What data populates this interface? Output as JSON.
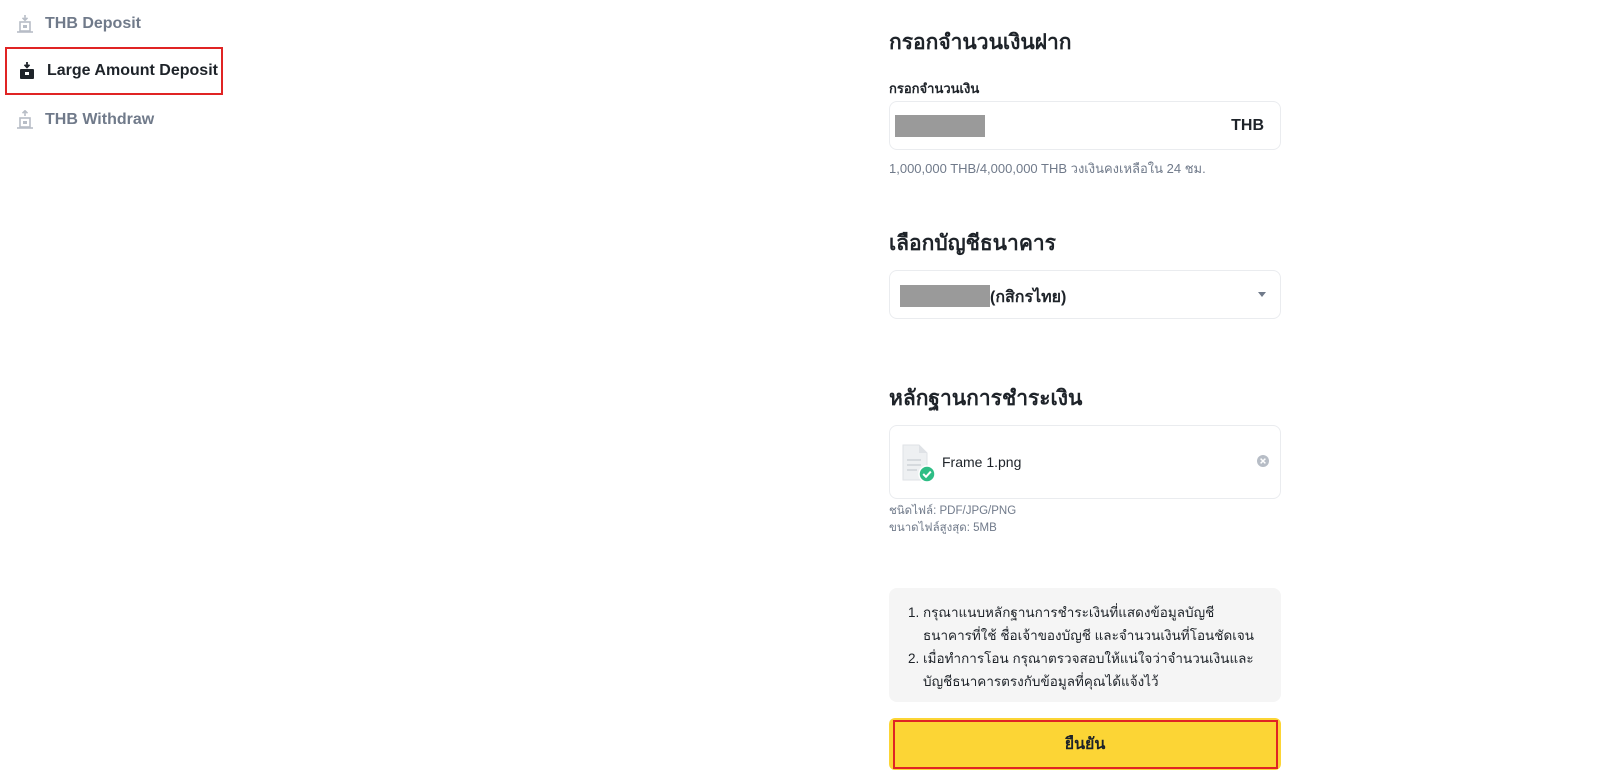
{
  "sidebar": {
    "items": [
      {
        "label": "THB Deposit",
        "icon": "deposit-icon",
        "active": false
      },
      {
        "label": "Large Amount Deposit",
        "icon": "large-deposit-icon",
        "active": true
      },
      {
        "label": "THB Withdraw",
        "icon": "withdraw-icon",
        "active": false
      }
    ]
  },
  "form": {
    "amount_section_title": "กรอกจำนวนเงินฝาก",
    "amount_label": "กรอกจำนวนเงิน",
    "amount_currency": "THB",
    "amount_limit_hint": "1,000,000 THB/4,000,000 THB วงเงินคงเหลือใน 24 ชม.",
    "bank_section_title": "เลือกบัญชีธนาคาร",
    "bank_selected": "(กสิกรไทย)",
    "proof_section_title": "หลักฐานการชำระเงิน",
    "uploaded_file_name": "Frame 1.png",
    "file_type_hint": "ชนิดไฟล์: PDF/JPG/PNG",
    "file_size_hint": "ขนาดไฟล์สูงสุด: 5MB",
    "notice_items": [
      "กรุณาแนบหลักฐานการชำระเงินที่แสดงข้อมูลบัญชีธนาคารที่ใช้ ชื่อเจ้าของบัญชี และจำนวนเงินที่โอนชัดเจน",
      "เมื่อทำการโอน กรุณาตรวจสอบให้แน่ใจว่าจำนวนเงินและบัญชีธนาคารตรงกับข้อมูลที่คุณได้แจ้งไว้"
    ],
    "confirm_label": "ยืนยัน"
  },
  "colors": {
    "accent_yellow": "#fcd535",
    "highlight_red": "#e02424",
    "success_green": "#2ebd85",
    "muted_text": "#707a8a"
  }
}
